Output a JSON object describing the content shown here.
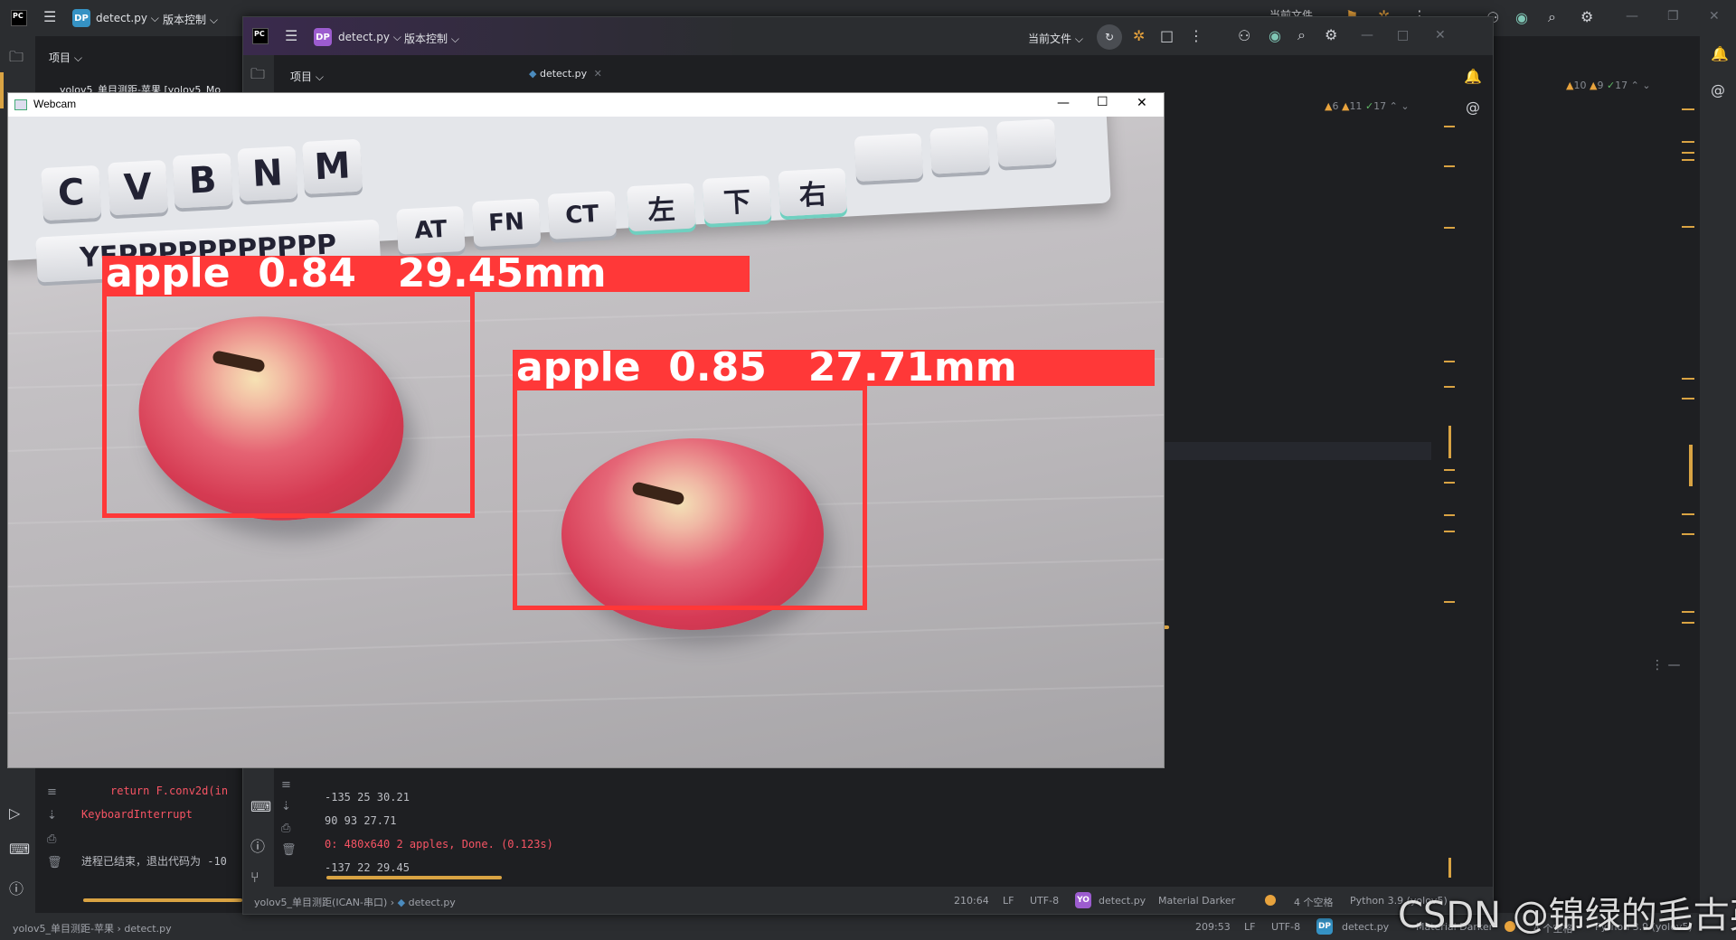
{
  "back_ide": {
    "project_badge": "DP",
    "project_name": "detect.py",
    "vcs_label": "版本控制",
    "project_tab": "项目",
    "tree_item": "yolov5_单目测距-苹果 [yolov5_Mo",
    "top_right_label": "当前文件",
    "inspection": {
      "warnings": "10",
      "weak": "9",
      "ok": "17"
    },
    "console_lines": [
      {
        "text": "return F.conv2d(in",
        "color": "#f75464"
      },
      {
        "text": "KeyboardInterrupt",
        "color": "#f75464"
      },
      {
        "text": "",
        "color": "#bcbec4"
      },
      {
        "text": "进程已结束，退出代码为 -10",
        "color": "#bcbec4"
      }
    ],
    "statusbar": {
      "breadcrumb_project": "yolov5_单目测距-苹果",
      "breadcrumb_file": "detect.py",
      "position": "209:53",
      "line_sep": "LF",
      "encoding": "UTF-8",
      "file_badge": "DP",
      "file": "detect.py",
      "theme": "Material Darker",
      "indent": "4 个空格",
      "interpreter": "Python 3.9 (yolov5)"
    }
  },
  "front_ide": {
    "project_badge": "DP",
    "project_name": "detect.py",
    "vcs_label": "版本控制",
    "run_config": "当前文件",
    "project_tab": "项目",
    "editor_tab": "detect.py",
    "inspection": {
      "warnings": "6",
      "weak": "11",
      "ok": "17"
    },
    "code_fragment": "' ')",
    "console_lines": [
      {
        "text": "-135 25 30.21",
        "color": "#bcbec4"
      },
      {
        "text": "90 93 27.71",
        "color": "#bcbec4"
      },
      {
        "text": "0: 480x640 2 apples, Done. (0.123s)",
        "color": "#f75464"
      },
      {
        "text": "-137 22 29.45",
        "color": "#bcbec4"
      }
    ],
    "statusbar": {
      "breadcrumb_project": "yolov5_单目测距(ICAN-串口)",
      "breadcrumb_file": "detect.py",
      "position": "210:64",
      "line_sep": "LF",
      "encoding": "UTF-8",
      "file_badge": "YO",
      "file": "detect.py",
      "theme": "Material Darker",
      "indent": "4 个空格",
      "interpreter": "Python 3.9 (yolov5)"
    }
  },
  "webcam": {
    "title": "Webcam",
    "detections": [
      {
        "label": "apple  0.84   29.45mm"
      },
      {
        "label": "apple  0.85   27.71mm"
      }
    ],
    "keyboard": {
      "row1": [
        "C",
        "V",
        "B",
        "N",
        "M"
      ],
      "row2": [
        "YEPPPPPPPPPPP",
        "AT",
        "FN",
        "CT",
        "左",
        "下",
        "右"
      ]
    }
  },
  "watermark": "CSDN @锦绿的毛古英",
  "colors": {
    "bbox": "#ff3838",
    "ide_bg": "#1e1f22",
    "accent_orange": "#d9a343"
  }
}
